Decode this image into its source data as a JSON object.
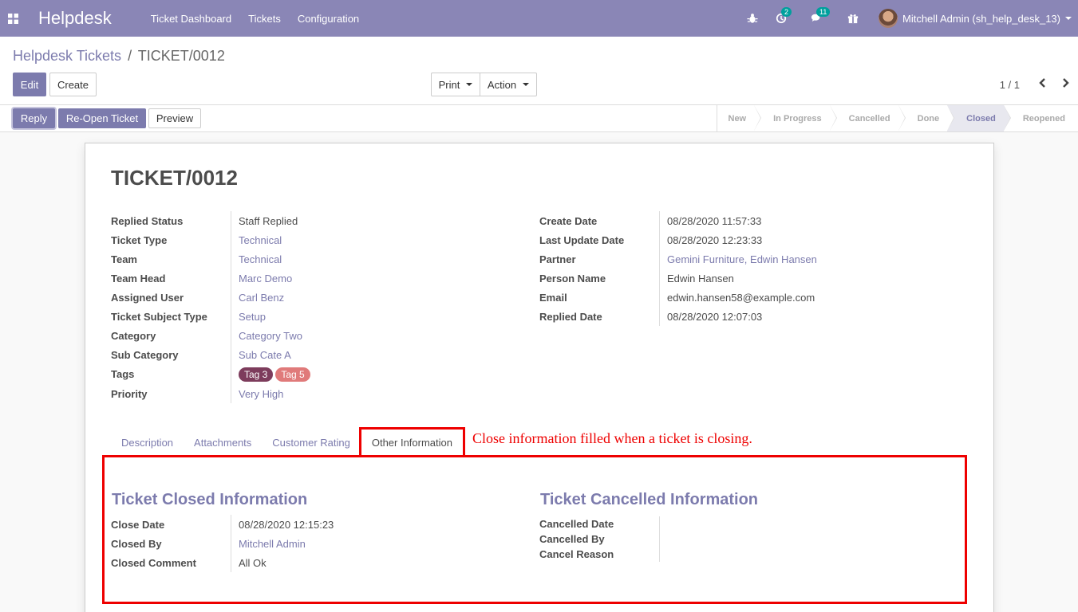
{
  "navbar": {
    "app_title": "Helpdesk",
    "menu": [
      "Ticket Dashboard",
      "Tickets",
      "Configuration"
    ],
    "activity_count": "2",
    "message_count": "11",
    "user": "Mitchell Admin (sh_help_desk_13)"
  },
  "breadcrumb": {
    "parent": "Helpdesk Tickets",
    "separator": "/",
    "current": "TICKET/0012"
  },
  "toolbar": {
    "edit": "Edit",
    "create": "Create",
    "print": "Print",
    "action": "Action",
    "pager": "1 / 1"
  },
  "statusbar": {
    "reply": "Reply",
    "reopen": "Re-Open Ticket",
    "preview": "Preview",
    "stages": [
      "New",
      "In Progress",
      "Cancelled",
      "Done",
      "Closed",
      "Reopened"
    ],
    "active_stage": "Closed"
  },
  "ticket": {
    "title": "TICKET/0012",
    "left_fields": [
      {
        "label": "Replied Status",
        "value": "Staff Replied"
      },
      {
        "label": "Ticket Type",
        "value": "Technical"
      },
      {
        "label": "Team",
        "value": "Technical"
      },
      {
        "label": "Team Head",
        "value": "Marc Demo"
      },
      {
        "label": "Assigned User",
        "value": "Carl Benz"
      },
      {
        "label": "Ticket Subject Type",
        "value": "Setup"
      },
      {
        "label": "Category",
        "value": "Category Two"
      },
      {
        "label": "Sub Category",
        "value": "Sub Cate A"
      },
      {
        "label": "Tags",
        "value": ""
      },
      {
        "label": "Priority",
        "value": "Very High"
      }
    ],
    "tags": [
      {
        "label": "Tag 3",
        "color": "#7d3c5c"
      },
      {
        "label": "Tag 5",
        "color": "#e07a7a"
      }
    ],
    "right_fields": [
      {
        "label": "Create Date",
        "value": "08/28/2020 11:57:33"
      },
      {
        "label": "Last Update Date",
        "value": "08/28/2020 12:23:33"
      },
      {
        "label": "Partner",
        "value": "Gemini Furniture, Edwin Hansen"
      },
      {
        "label": "Person Name",
        "value": "Edwin Hansen"
      },
      {
        "label": "Email",
        "value": "edwin.hansen58@example.com"
      },
      {
        "label": "Replied Date",
        "value": "08/28/2020 12:07:03"
      }
    ]
  },
  "tabs": [
    "Description",
    "Attachments",
    "Customer Rating",
    "Other Information"
  ],
  "active_tab": "Other Information",
  "annotation": "Close information filled when a ticket is closing.",
  "closed_info": {
    "title": "Ticket Closed Information",
    "fields": [
      {
        "label": "Close Date",
        "value": "08/28/2020 12:15:23"
      },
      {
        "label": "Closed By",
        "value": "Mitchell Admin"
      },
      {
        "label": "Closed Comment",
        "value": "All Ok"
      }
    ]
  },
  "cancelled_info": {
    "title": "Ticket Cancelled Information",
    "fields": [
      {
        "label": "Cancelled Date",
        "value": ""
      },
      {
        "label": "Cancelled By",
        "value": ""
      },
      {
        "label": "Cancel Reason",
        "value": ""
      }
    ]
  },
  "colors": {
    "navbar": "#8a86b6",
    "primary": "#7c7bad",
    "annotation": "#e00000"
  }
}
